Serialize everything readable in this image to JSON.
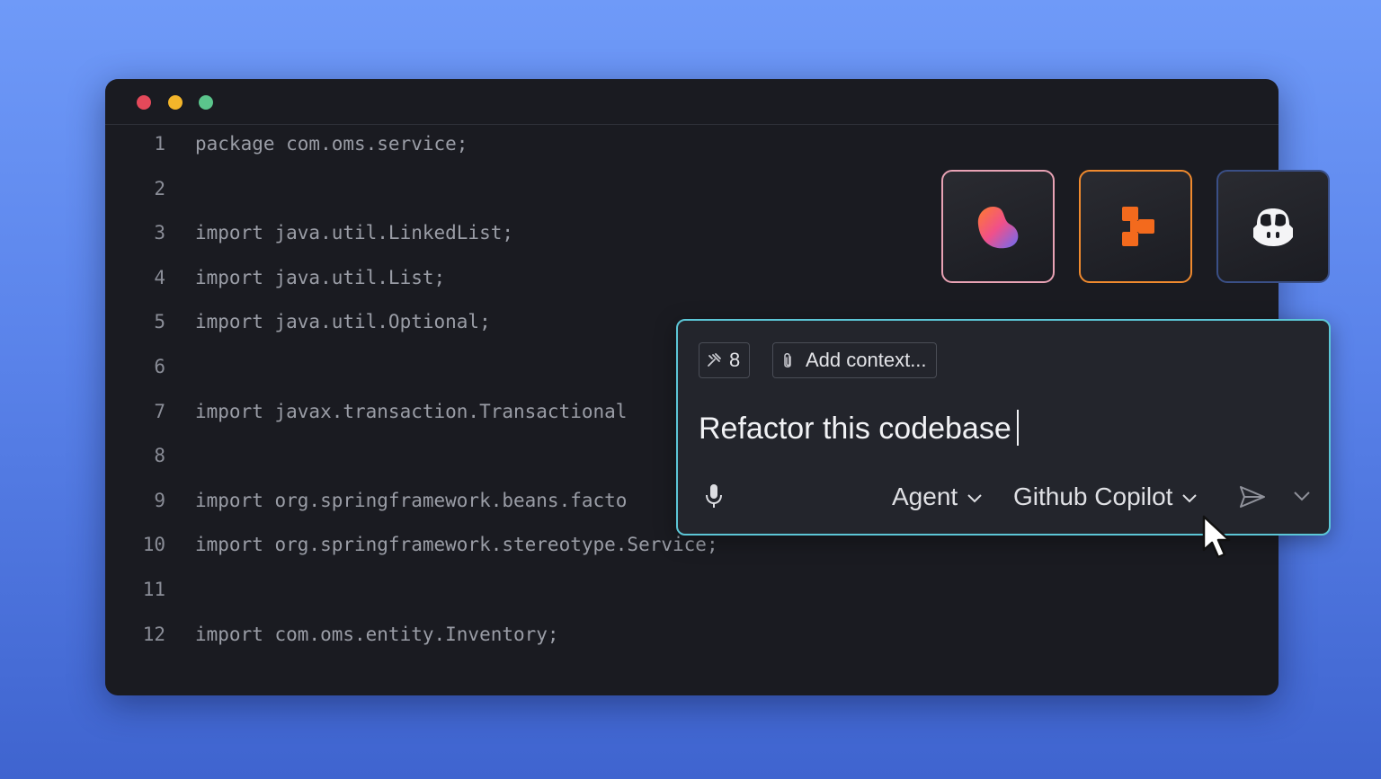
{
  "editor": {
    "lines": [
      {
        "num": "1",
        "text": "package com.oms.service;"
      },
      {
        "num": "2",
        "text": ""
      },
      {
        "num": "3",
        "text": "import java.util.LinkedList;"
      },
      {
        "num": "4",
        "text": "import java.util.List;"
      },
      {
        "num": "5",
        "text": "import java.util.Optional;"
      },
      {
        "num": "6",
        "text": ""
      },
      {
        "num": "7",
        "text": "import javax.transaction.Transactional"
      },
      {
        "num": "8",
        "text": ""
      },
      {
        "num": "9",
        "text": "import org.springframework.beans.facto"
      },
      {
        "num": "10",
        "text": "import org.springframework.stereotype.Service;"
      },
      {
        "num": "11",
        "text": ""
      },
      {
        "num": "12",
        "text": "import com.oms.entity.Inventory;"
      }
    ]
  },
  "tiles": [
    {
      "icon": "gradient-blob-logo-icon",
      "accent": "#e8a2b4"
    },
    {
      "icon": "orange-blocks-logo-icon",
      "accent": "#f08a2e"
    },
    {
      "icon": "copilot-logo-icon",
      "accent": "#3a4f86"
    }
  ],
  "chat": {
    "tools_count": "8",
    "add_context_label": "Add context...",
    "prompt_text": "Refactor this codebase",
    "mode_label": "Agent",
    "model_label": "Github Copilot",
    "border_color": "#5cc6d6"
  }
}
